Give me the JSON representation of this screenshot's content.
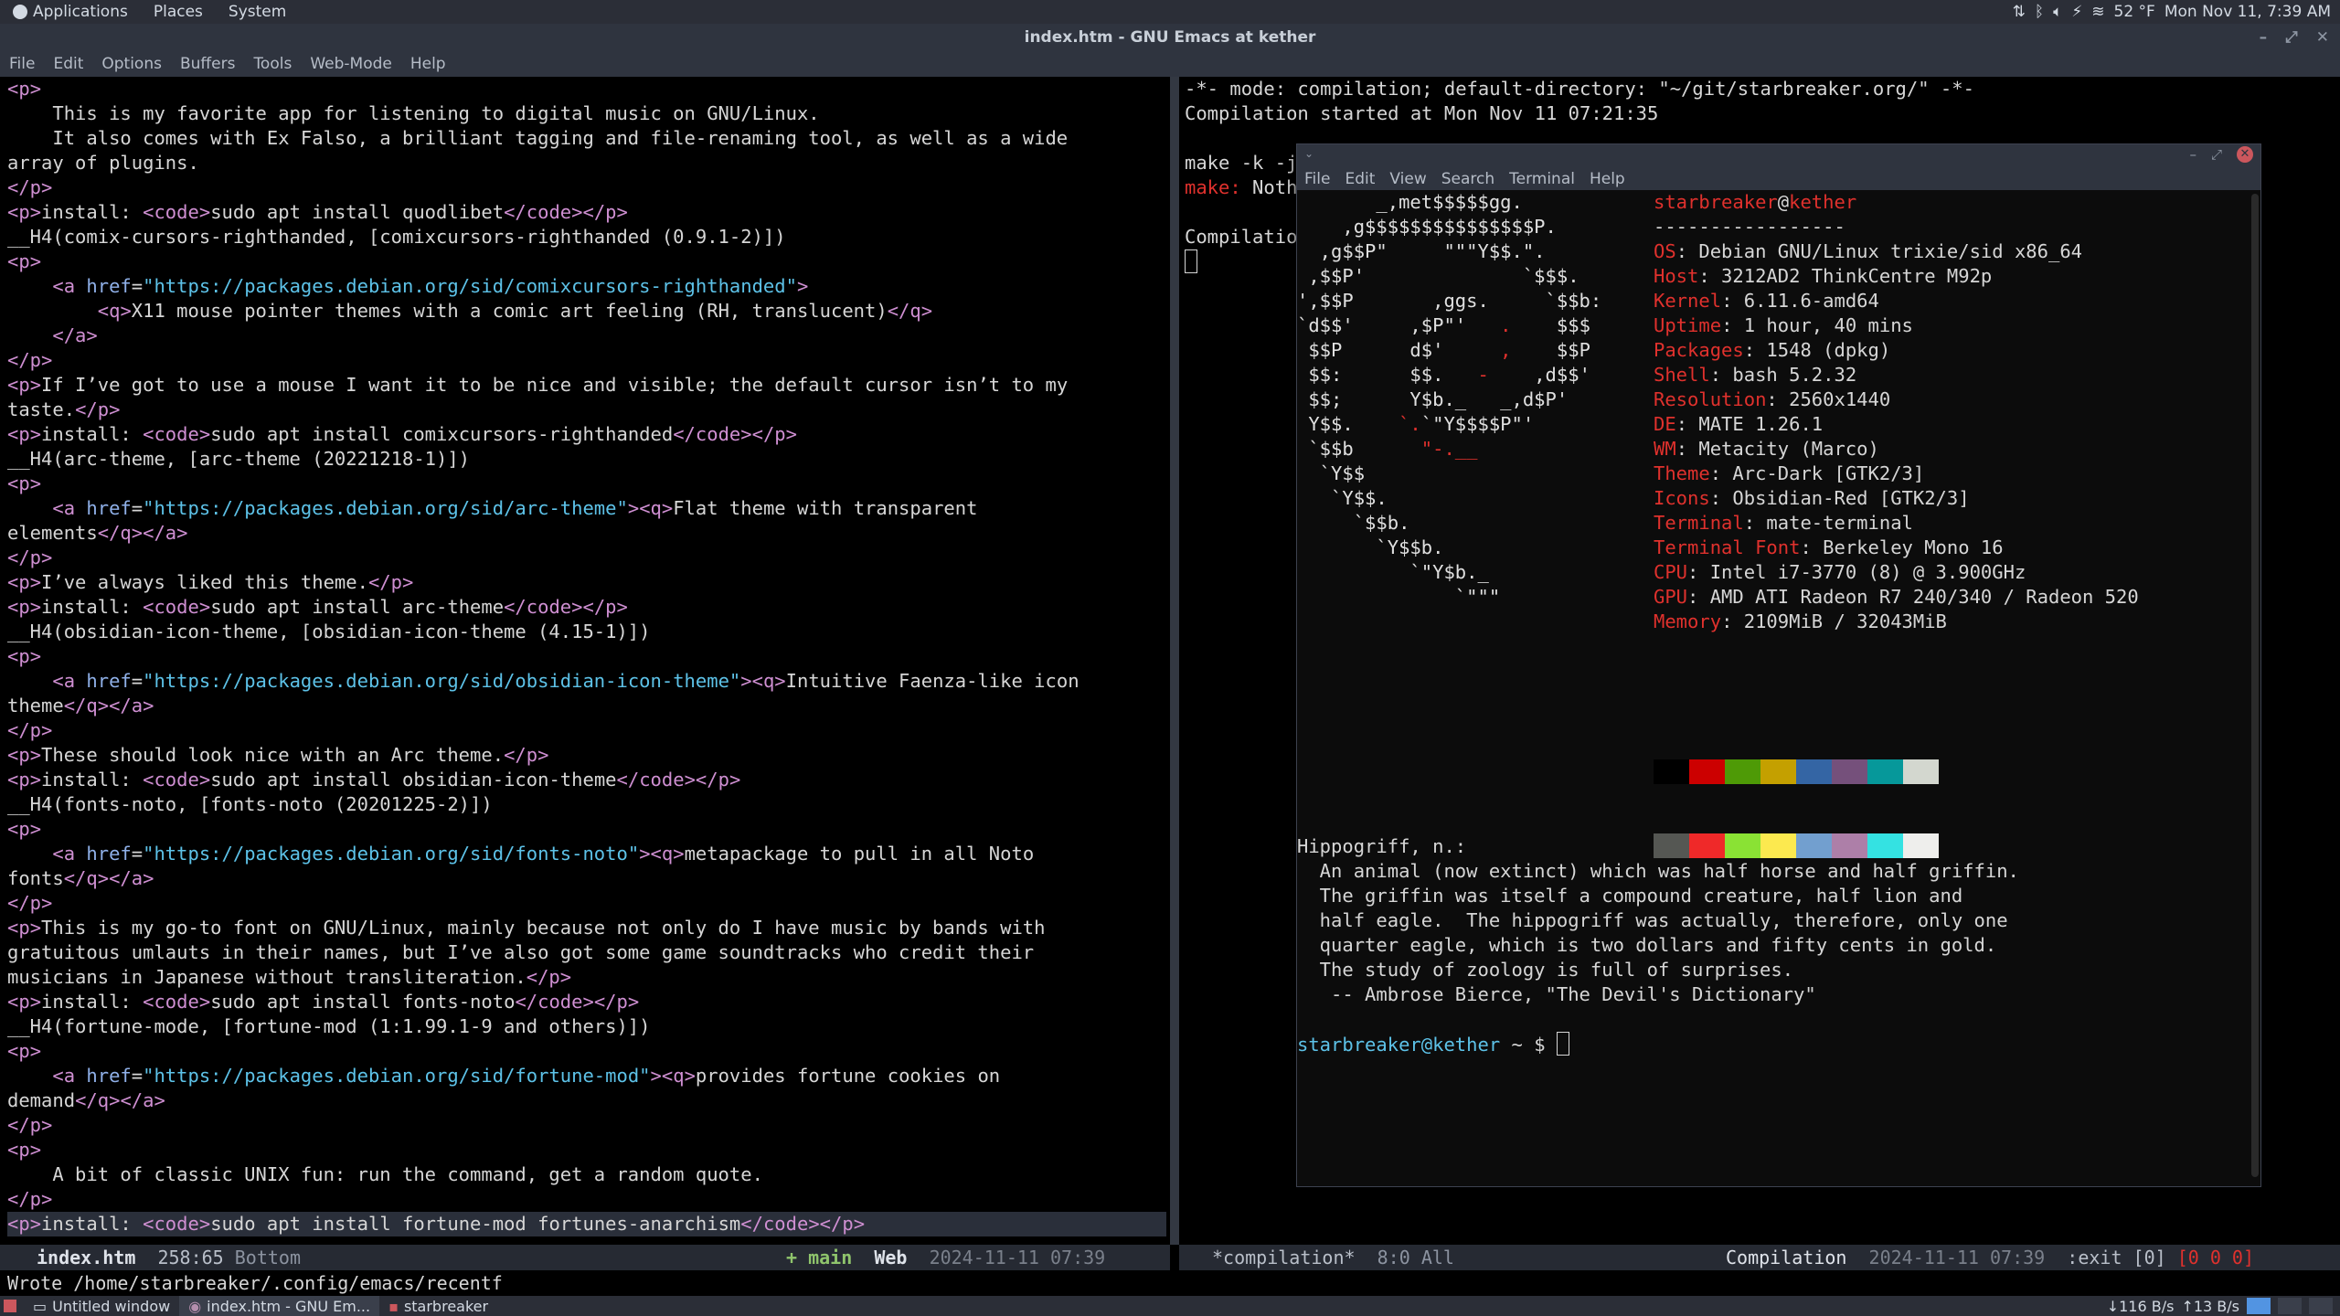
{
  "top_panel": {
    "menus": [
      "Applications",
      "Places",
      "System"
    ],
    "weather": "52 °F",
    "datetime": "Mon Nov 11, 7:39 AM"
  },
  "emacs": {
    "title": "index.htm - GNU Emacs at kether",
    "menus": [
      "File",
      "Edit",
      "Options",
      "Buffers",
      "Tools",
      "Web-Mode",
      "Help"
    ],
    "left_lines": [
      "<p>",
      "    This is my favorite app for listening to digital music on GNU/Linux.",
      "    It also comes with Ex Falso, a brilliant tagging and file-renaming tool, as well as a wide",
      "array of plugins.",
      "</p>",
      "<p>install: <code>sudo apt install quodlibet</code></p>",
      "__H4(comix-cursors-righthanded, [comixcursors-righthanded (0.9.1-2)])",
      "<p>",
      "    <a href=\"https://packages.debian.org/sid/comixcursors-righthanded\">",
      "        <q>X11 mouse pointer themes with a comic art feeling (RH, translucent)</q>",
      "    </a>",
      "</p>",
      "<p>If I’ve got to use a mouse I want it to be nice and visible; the default cursor isn’t to my",
      "taste.</p>",
      "<p>install: <code>sudo apt install comixcursors-righthanded</code></p>",
      "__H4(arc-theme, [arc-theme (20221218-1)])",
      "<p>",
      "    <a href=\"https://packages.debian.org/sid/arc-theme\"><q>Flat theme with transparent",
      "elements</q></a>",
      "</p>",
      "<p>I’ve always liked this theme.</p>",
      "<p>install: <code>sudo apt install arc-theme</code></p>",
      "__H4(obsidian-icon-theme, [obsidian-icon-theme (4.15-1)])",
      "<p>",
      "    <a href=\"https://packages.debian.org/sid/obsidian-icon-theme\"><q>Intuitive Faenza-like icon",
      "theme</q></a>",
      "</p>",
      "<p>These should look nice with an Arc theme.</p>",
      "<p>install: <code>sudo apt install obsidian-icon-theme</code></p>",
      "__H4(fonts-noto, [fonts-noto (20201225-2)])",
      "<p>",
      "    <a href=\"https://packages.debian.org/sid/fonts-noto\"><q>metapackage to pull in all Noto",
      "fonts</q></a>",
      "</p>",
      "<p>This is my go-to font on GNU/Linux, mainly because not only do I have music by bands with",
      "gratuitous umlauts in their names, but I’ve also got some game soundtracks who credit their",
      "musicians in Japanese without transliteration.</p>",
      "<p>install: <code>sudo apt install fonts-noto</code></p>",
      "__H4(fortune-mode, [fortune-mod (1:1.99.1-9 and others)])",
      "<p>",
      "    <a href=\"https://packages.debian.org/sid/fortune-mod\"><q>provides fortune cookies on",
      "demand</q></a>",
      "</p>",
      "<p>",
      "    A bit of classic UNIX fun: run the command, get a random quote.",
      "</p>",
      "<p>install: <code>sudo apt install fortune-mod fortunes-anarchism</code></p>"
    ],
    "right_lines": [
      "-*- mode: compilation; default-directory: \"~/git/starbreaker.org/\" -*-",
      "Compilation started at Mon Nov 11 07:21:35",
      "",
      "make -k -j",
      "make: Noth",
      "",
      "Compilatio"
    ],
    "modeline_left": {
      "buffer": "index.htm",
      "position": "258:65",
      "scroll": "Bottom",
      "branch": "+ main",
      "mode": "Web",
      "time": "2024-11-11 07:39"
    },
    "modeline_right": {
      "buffer": "*compilation*",
      "position": "8:0",
      "scroll": "All",
      "mode": "Compilation",
      "time": "2024-11-11 07:39",
      "status": ":exit [0]",
      "counts": "[0 0 0]"
    },
    "echo": "Wrote /home/starbreaker/.config/emacs/recentf"
  },
  "terminal": {
    "menus": [
      "File",
      "Edit",
      "View",
      "Search",
      "Terminal",
      "Help"
    ],
    "user": "starbreaker",
    "host": "kether",
    "separator": "-----------------",
    "info": [
      {
        "key": "OS",
        "value": "Debian GNU/Linux trixie/sid x86_64"
      },
      {
        "key": "Host",
        "value": "3212AD2 ThinkCentre M92p"
      },
      {
        "key": "Kernel",
        "value": "6.11.6-amd64"
      },
      {
        "key": "Uptime",
        "value": "1 hour, 40 mins"
      },
      {
        "key": "Packages",
        "value": "1548 (dpkg)"
      },
      {
        "key": "Shell",
        "value": "bash 5.2.32"
      },
      {
        "key": "Resolution",
        "value": "2560x1440"
      },
      {
        "key": "DE",
        "value": "MATE 1.26.1"
      },
      {
        "key": "WM",
        "value": "Metacity (Marco)"
      },
      {
        "key": "Theme",
        "value": "Arc-Dark [GTK2/3]"
      },
      {
        "key": "Icons",
        "value": "Obsidian-Red [GTK2/3]"
      },
      {
        "key": "Terminal",
        "value": "mate-terminal"
      },
      {
        "key": "Terminal Font",
        "value": "Berkeley Mono 16"
      },
      {
        "key": "CPU",
        "value": "Intel i7-3770 (8) @ 3.900GHz"
      },
      {
        "key": "GPU",
        "value": "AMD ATI Radeon R7 240/340 / Radeon 520"
      },
      {
        "key": "Memory",
        "value": "2109MiB / 32043MiB"
      }
    ],
    "palette_top": [
      "#000000",
      "#cc0000",
      "#4e9a06",
      "#c4a000",
      "#3465a4",
      "#75507b",
      "#06989a",
      "#d3d7cf"
    ],
    "palette_bottom": [
      "#555753",
      "#ef2929",
      "#8ae234",
      "#fce94f",
      "#729fcf",
      "#ad7fa8",
      "#34e2e2",
      "#eeeeec"
    ],
    "fortune": [
      "Hippogriff, n.:",
      "  An animal (now extinct) which was half horse and half griffin.",
      "  The griffin was itself a compound creature, half lion and",
      "  half eagle.  The hippogriff was actually, therefore, only one",
      "  quarter eagle, which is two dollars and fifty cents in gold.",
      "  The study of zoology is full of surprises.",
      "   -- Ambrose Bierce, \"The Devil's Dictionary\""
    ],
    "prompt_suffix": " ~ $ "
  },
  "taskbar": {
    "tasks": [
      "Untitled window",
      "index.htm - GNU Em...",
      "starbreaker"
    ],
    "net_down": "116 B/s",
    "net_up": "13 B/s"
  }
}
